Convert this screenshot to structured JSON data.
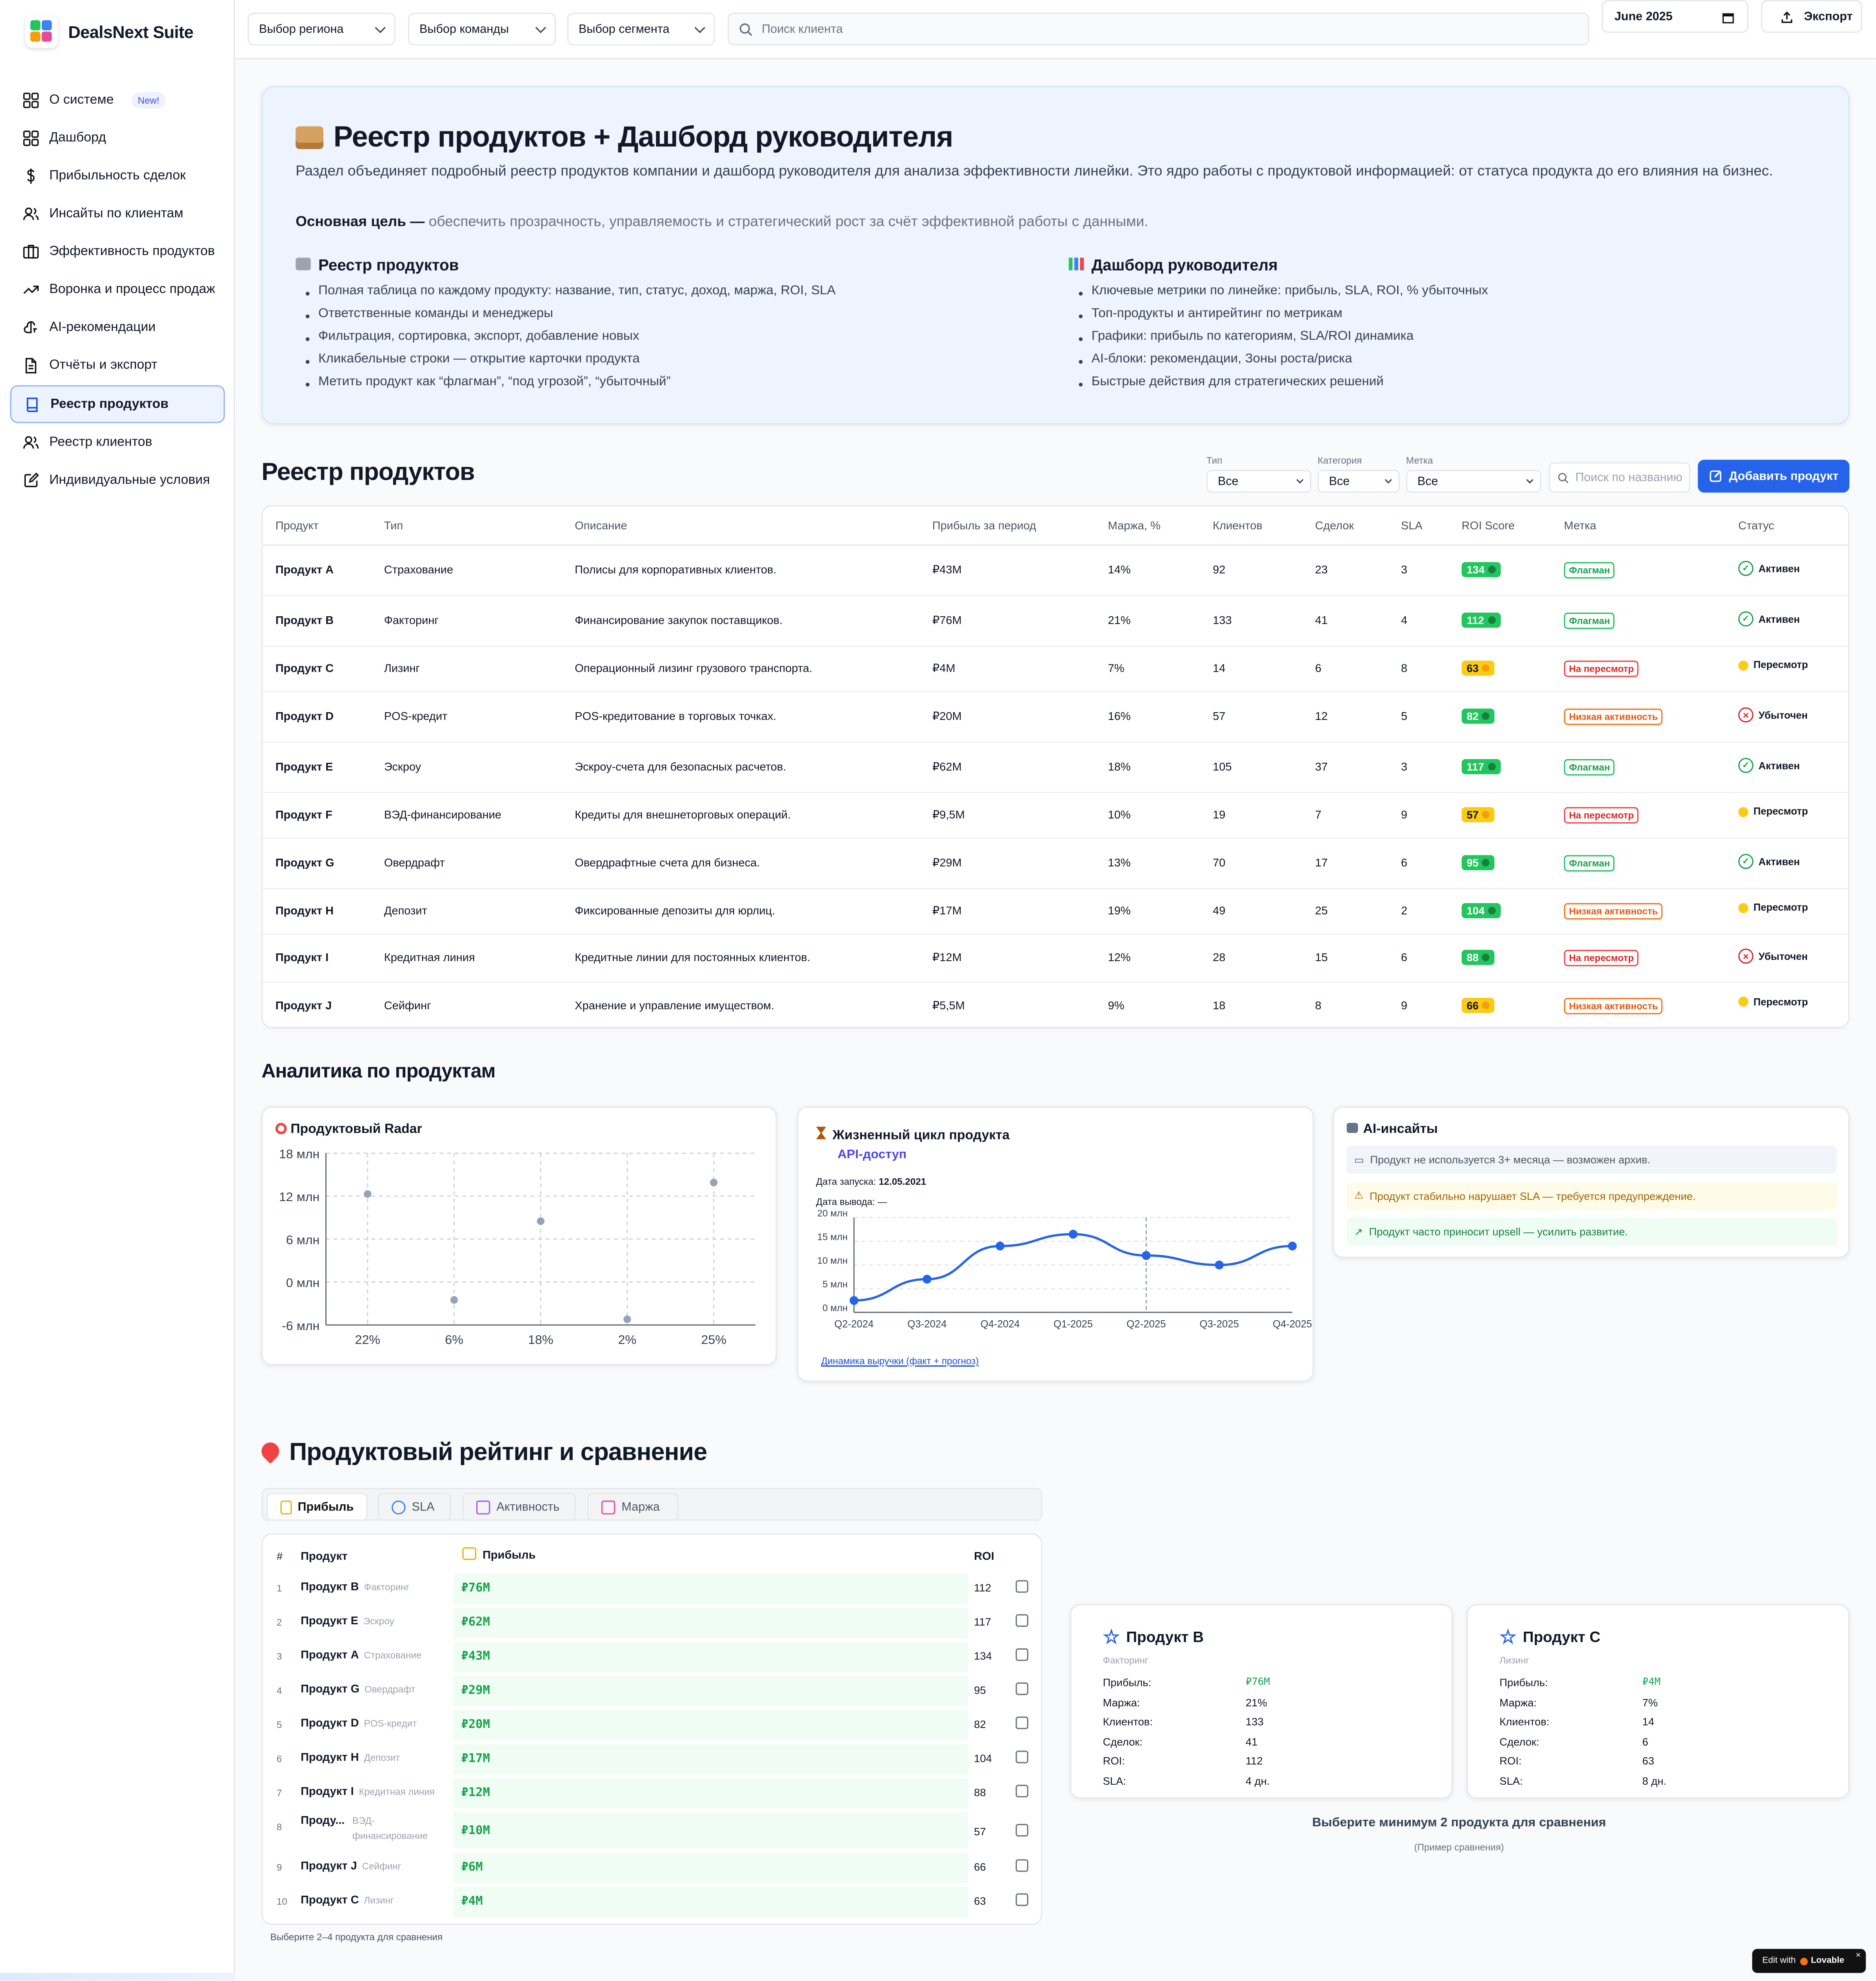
{
  "app": {
    "name": "DealsNext Suite"
  },
  "sidebar": {
    "items": [
      {
        "label": "О системе",
        "badge": "New!",
        "icon": "grid-icon"
      },
      {
        "label": "Дашборд",
        "icon": "grid-icon"
      },
      {
        "label": "Прибыльность сделок",
        "icon": "dollar-icon"
      },
      {
        "label": "Инсайты по клиентам",
        "icon": "users-icon"
      },
      {
        "label": "Эффективность продуктов",
        "icon": "box-icon"
      },
      {
        "label": "Воронка и процесс продаж",
        "icon": "trend-icon"
      },
      {
        "label": "AI-рекомендации",
        "icon": "brain-icon"
      },
      {
        "label": "Отчёты и экспорт",
        "icon": "file-icon"
      },
      {
        "label": "Реестр продуктов",
        "icon": "book-icon",
        "active": true
      },
      {
        "label": "Реестр клиентов",
        "icon": "users-icon"
      },
      {
        "label": "Индивидуальные условия",
        "icon": "edit-icon"
      }
    ]
  },
  "topbar": {
    "region": "Выбор региона",
    "team": "Выбор команды",
    "segment": "Выбор сегмента",
    "search_placeholder": "Поиск клиента",
    "date": "June 2025",
    "export": "Экспорт"
  },
  "hero": {
    "title": "Реестр продуктов + Дашборд руководителя",
    "description": "Раздел объединяет подробный реестр продуктов компании и дашборд руководителя для анализа эффективности линейки. Это ядро работы с продуктовой информацией: от статуса продукта до его влияния на бизнес.",
    "goal_label": "Основная цель —",
    "goal_text": "обеспечить прозрачность, управляемость и стратегический рост за счёт эффективной работы с данными.",
    "left": {
      "title": "Реестр продуктов",
      "items": [
        "Полная таблица по каждому продукту: название, тип, статус, доход, маржа, ROI, SLA",
        "Ответственные команды и менеджеры",
        "Фильтрация, сортировка, экспорт, добавление новых",
        "Кликабельные строки — открытие карточки продукта",
        "Метить продукт как “флагман”, “под угрозой”, “убыточный”"
      ]
    },
    "right": {
      "title": "Дашборд руководителя",
      "items": [
        "Ключевые метрики по линейке: прибыль, SLA, ROI, % убыточных",
        "Топ-продукты и антирейтинг по метрикам",
        "Графики: прибыль по категориям, SLA/ROI динамика",
        "AI-блоки: рекомендации, Зоны роста/риска",
        "Быстрые действия для стратегических решений"
      ]
    }
  },
  "registry": {
    "title": "Реестр продуктов",
    "filters": {
      "type_label": "Тип",
      "type_value": "Все",
      "category_label": "Категория",
      "category_value": "Все",
      "tag_label": "Метка",
      "tag_value": "Все",
      "search_placeholder": "Поиск по названию"
    },
    "add_button": "Добавить продукт",
    "columns": [
      "Продукт",
      "Тип",
      "Описание",
      "Прибыль за период",
      "Маржа, %",
      "Клиентов",
      "Сделок",
      "SLA",
      "ROI Score",
      "Метка",
      "Статус"
    ],
    "rows": [
      {
        "product": "Продукт A",
        "type": "Страхование",
        "desc": "Полисы для корпоративных клиентов.",
        "profit": "₽43M",
        "margin": "14%",
        "clients": "92",
        "deals": "23",
        "sla": "3",
        "roi": "134",
        "roi_color": "g",
        "tag": "Флагман",
        "tag_color": "green",
        "status": "Активен",
        "status_kind": "ok"
      },
      {
        "product": "Продукт B",
        "type": "Факторинг",
        "desc": "Финансирование закупок поставщиков.",
        "profit": "₽76M",
        "margin": "21%",
        "clients": "133",
        "deals": "41",
        "sla": "4",
        "roi": "112",
        "roi_color": "g",
        "tag": "Флагман",
        "tag_color": "green",
        "status": "Активен",
        "status_kind": "ok"
      },
      {
        "product": "Продукт C",
        "type": "Лизинг",
        "desc": "Операционный лизинг грузового транспорта.",
        "profit": "₽4M",
        "margin": "7%",
        "clients": "14",
        "deals": "6",
        "sla": "8",
        "roi": "63",
        "roi_color": "y",
        "tag": "На пересмотр",
        "tag_color": "red",
        "status": "Пересмотр",
        "status_kind": "rev"
      },
      {
        "product": "Продукт D",
        "type": "POS-кредит",
        "desc": "POS-кредитование в торговых точках.",
        "profit": "₽20M",
        "margin": "16%",
        "clients": "57",
        "deals": "12",
        "sla": "5",
        "roi": "82",
        "roi_color": "g",
        "tag": "Низкая активность",
        "tag_color": "orange",
        "status": "Убыточен",
        "status_kind": "bad"
      },
      {
        "product": "Продукт E",
        "type": "Эскроу",
        "desc": "Эскроу-счета для безопасных расчетов.",
        "profit": "₽62M",
        "margin": "18%",
        "clients": "105",
        "deals": "37",
        "sla": "3",
        "roi": "117",
        "roi_color": "g",
        "tag": "Флагман",
        "tag_color": "green",
        "status": "Активен",
        "status_kind": "ok"
      },
      {
        "product": "Продукт F",
        "type": "ВЭД-финансирование",
        "desc": "Кредиты для внешнеторговых операций.",
        "profit": "₽9,5M",
        "margin": "10%",
        "clients": "19",
        "deals": "7",
        "sla": "9",
        "roi": "57",
        "roi_color": "y",
        "tag": "На пересмотр",
        "tag_color": "red",
        "status": "Пересмотр",
        "status_kind": "rev"
      },
      {
        "product": "Продукт G",
        "type": "Овердрафт",
        "desc": "Овердрафтные счета для бизнеса.",
        "profit": "₽29M",
        "margin": "13%",
        "clients": "70",
        "deals": "17",
        "sla": "6",
        "roi": "95",
        "roi_color": "g",
        "tag": "Флагман",
        "tag_color": "green",
        "status": "Активен",
        "status_kind": "ok"
      },
      {
        "product": "Продукт H",
        "type": "Депозит",
        "desc": "Фиксированные депозиты для юрлиц.",
        "profit": "₽17M",
        "margin": "19%",
        "clients": "49",
        "deals": "25",
        "sla": "2",
        "roi": "104",
        "roi_color": "g",
        "tag": "Низкая активность",
        "tag_color": "orange",
        "status": "Пересмотр",
        "status_kind": "rev"
      },
      {
        "product": "Продукт I",
        "type": "Кредитная линия",
        "desc": "Кредитные линии для постоянных клиентов.",
        "profit": "₽12M",
        "margin": "12%",
        "clients": "28",
        "deals": "15",
        "sla": "6",
        "roi": "88",
        "roi_color": "g",
        "tag": "На пересмотр",
        "tag_color": "red",
        "status": "Убыточен",
        "status_kind": "bad"
      },
      {
        "product": "Продукт J",
        "type": "Сейфинг",
        "desc": "Хранение и управление имуществом.",
        "profit": "₽5,5M",
        "margin": "9%",
        "clients": "18",
        "deals": "8",
        "sla": "9",
        "roi": "66",
        "roi_color": "y",
        "tag": "Низкая активность",
        "tag_color": "orange",
        "status": "Пересмотр",
        "status_kind": "rev"
      }
    ]
  },
  "analytics": {
    "title": "Аналитика по продуктам",
    "radar": {
      "title": "Продуктовый Radar"
    },
    "lifecycle": {
      "title": "Жизненный цикл продукта",
      "product": "API-доступ",
      "launch_label": "Дата запуска:",
      "launch_date": "12.05.2021",
      "end_label": "Дата вывода:",
      "end_date": "—",
      "link": "Динамика выручки (факт + прогноз)"
    },
    "ai": {
      "title": "AI-инсайты",
      "insights": [
        {
          "text": "Продукт не используется 3+ месяца — возможен архив.",
          "kind": "gray"
        },
        {
          "text": "Продукт стабильно нарушает SLA — требуется предупреждение.",
          "kind": "yellow"
        },
        {
          "text": "Продукт часто приносит upsell — усилить развитие.",
          "kind": "green"
        }
      ]
    }
  },
  "chart_data": [
    {
      "type": "scatter",
      "title": "Продуктовый Radar",
      "x_ticks": [
        "22%",
        "6%",
        "18%",
        "2%",
        "25%"
      ],
      "y_ticks": [
        "18 млн",
        "12 млн",
        "6 млн",
        "0 млн",
        "-6 млн"
      ],
      "ylim": [
        -6,
        18
      ],
      "points": [
        {
          "x": "22%",
          "y": 12.3
        },
        {
          "x": "6%",
          "y": -2.5
        },
        {
          "x": "18%",
          "y": 8.5
        },
        {
          "x": "2%",
          "y": -5.2
        },
        {
          "x": "25%",
          "y": 13.9
        }
      ]
    },
    {
      "type": "line",
      "title": "Динамика выручки (факт + прогноз)",
      "categories": [
        "Q2-2024",
        "Q3-2024",
        "Q4-2024",
        "Q1-2025",
        "Q2-2025",
        "Q3-2025",
        "Q4-2025"
      ],
      "values": [
        2.5,
        7,
        14,
        16.5,
        12,
        10,
        14
      ],
      "y_ticks": [
        "20 млн",
        "15 млн",
        "10 млн",
        "5 млн",
        "0 млн"
      ],
      "ylim": [
        0,
        20
      ]
    }
  ],
  "ranking": {
    "title": "Продуктовый рейтинг и сравнение",
    "tabs": [
      {
        "label": "Прибыль",
        "active": true
      },
      {
        "label": "SLA"
      },
      {
        "label": "Активность"
      },
      {
        "label": "Маржа"
      }
    ],
    "col_num": "#",
    "col_product": "Продукт",
    "col_metric": "Прибыль",
    "col_roi": "ROI",
    "rows": [
      {
        "n": "1",
        "product": "Продукт B",
        "cat": "Факторинг",
        "value": "₽76M",
        "roi": "112"
      },
      {
        "n": "2",
        "product": "Продукт E",
        "cat": "Эскроу",
        "value": "₽62M",
        "roi": "117"
      },
      {
        "n": "3",
        "product": "Продукт A",
        "cat": "Страхование",
        "value": "₽43M",
        "roi": "134"
      },
      {
        "n": "4",
        "product": "Продукт G",
        "cat": "Овердрафт",
        "value": "₽29M",
        "roi": "95"
      },
      {
        "n": "5",
        "product": "Продукт D",
        "cat": "POS-кредит",
        "value": "₽20M",
        "roi": "82"
      },
      {
        "n": "6",
        "product": "Продукт H",
        "cat": "Депозит",
        "value": "₽17M",
        "roi": "104"
      },
      {
        "n": "7",
        "product": "Продукт I",
        "cat": "Кредитная линия",
        "value": "₽12M",
        "roi": "88"
      },
      {
        "n": "8",
        "product": "Проду...",
        "cat": "ВЭД-финансирование",
        "value": "₽10M",
        "roi": "57"
      },
      {
        "n": "9",
        "product": "Продукт J",
        "cat": "Сейфинг",
        "value": "₽6M",
        "roi": "66"
      },
      {
        "n": "10",
        "product": "Продукт C",
        "cat": "Лизинг",
        "value": "₽4M",
        "roi": "63"
      }
    ],
    "hint": "Выберите 2–4 продукта для сравнения"
  },
  "compare": {
    "cards": [
      {
        "name": "Продукт B",
        "cat": "Факторинг",
        "profit": "₽76M",
        "margin": "21%",
        "clients": "133",
        "deals": "41",
        "roi": "112",
        "sla": "4 дн."
      },
      {
        "name": "Продукт C",
        "cat": "Лизинг",
        "profit": "₽4M",
        "margin": "7%",
        "clients": "14",
        "deals": "6",
        "roi": "63",
        "sla": "8 дн."
      }
    ],
    "labels": {
      "profit": "Прибыль:",
      "margin": "Маржа:",
      "clients": "Клиентов:",
      "deals": "Сделок:",
      "roi": "ROI:",
      "sla": "SLA:"
    },
    "hint": "Выберите минимум 2 продукта для сравнения",
    "sub": "(Пример сравнения)"
  },
  "badge": {
    "prefix": "Edit with",
    "brand": "Lovable"
  }
}
